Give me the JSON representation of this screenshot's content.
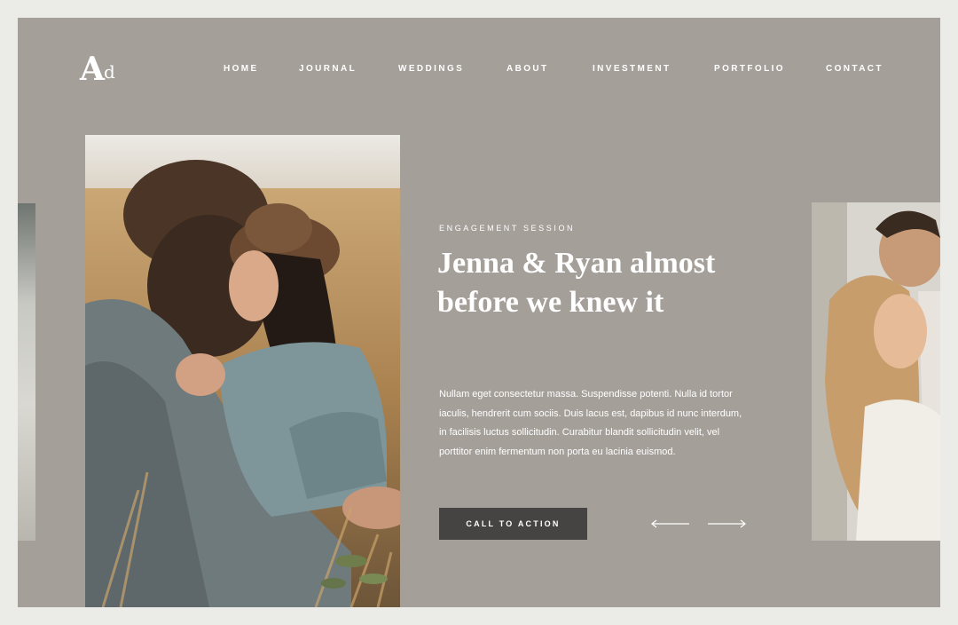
{
  "brand": {
    "logo_big": "A",
    "logo_small": "d"
  },
  "nav": {
    "items": [
      {
        "label": "HOME"
      },
      {
        "label": "JOURNAL"
      },
      {
        "label": "WEDDINGS"
      },
      {
        "label": "ABOUT"
      },
      {
        "label": "INVESTMENT"
      },
      {
        "label": "PORTFOLIO"
      },
      {
        "label": "CONTACT"
      }
    ]
  },
  "hero": {
    "eyebrow": "ENGAGEMENT SESSION",
    "headline_line1": "Jenna & Ryan almost",
    "headline_line2": "before we knew it",
    "body_line1": "Nullam eget consectetur massa. Suspendisse potenti. Nulla id tortor",
    "body_line2": "iaculis, hendrerit cum sociis. Duis lacus est, dapibus id nunc interdum,",
    "body_line3": "in facilisis luctus sollicitudin. Curabitur blandit sollicitudin velit, vel",
    "body_line4": "porttitor enim fermentum non porta eu lacinia euismod.",
    "cta_label": "CALL TO ACTION"
  },
  "icons": {
    "prev": "arrow-left-icon",
    "next": "arrow-right-icon"
  },
  "colors": {
    "page_bg": "#ebebe7",
    "panel_bg": "#a59f99",
    "cta_bg": "#464443",
    "text": "#ffffff"
  }
}
